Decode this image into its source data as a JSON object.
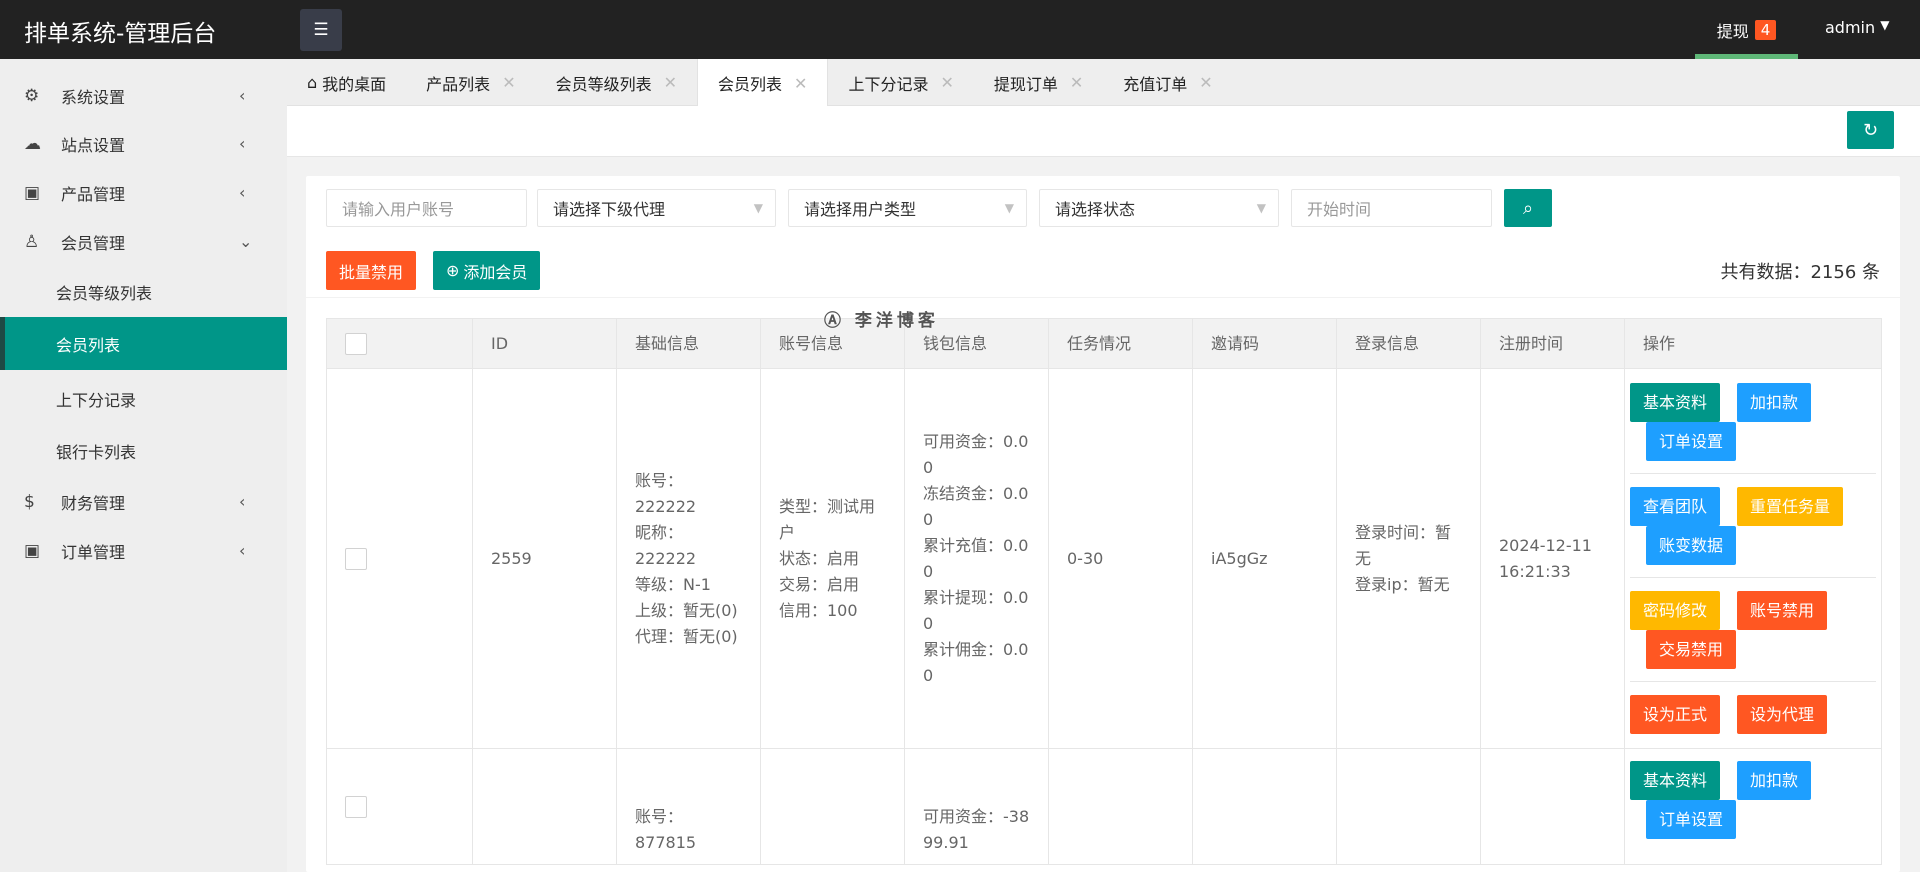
{
  "header": {
    "title": "排单系统-管理后台",
    "withdraw_label": "提现",
    "withdraw_count": "4",
    "user": "admin"
  },
  "sidebar": {
    "items": [
      {
        "label": "系统设置",
        "icon": "gear-icon"
      },
      {
        "label": "站点设置",
        "icon": "cloud-icon"
      },
      {
        "label": "产品管理",
        "icon": "box-icon"
      },
      {
        "label": "会员管理",
        "icon": "user-icon"
      },
      {
        "label": "会员等级列表"
      },
      {
        "label": "会员列表"
      },
      {
        "label": "上下分记录"
      },
      {
        "label": "银行卡列表"
      },
      {
        "label": "财务管理",
        "icon": "dollar-icon"
      },
      {
        "label": "订单管理",
        "icon": "box-icon"
      }
    ]
  },
  "tabs": [
    {
      "label": "我的桌面"
    },
    {
      "label": "产品列表"
    },
    {
      "label": "会员等级列表"
    },
    {
      "label": "会员列表"
    },
    {
      "label": "上下分记录"
    },
    {
      "label": "提现订单"
    },
    {
      "label": "充值订单"
    }
  ],
  "filters": {
    "account_placeholder": "请输入用户账号",
    "agent": "请选择下级代理",
    "user_type": "请选择用户类型",
    "status": "请选择状态",
    "start_placeholder": "开始时间"
  },
  "actions": {
    "batch_disable": "批量禁用",
    "add_member": "添加会员",
    "total": "共有数据：2156 条"
  },
  "watermark": "李洋博客",
  "table": {
    "headers": [
      "ID",
      "基础信息",
      "账号信息",
      "钱包信息",
      "任务情况",
      "邀请码",
      "登录信息",
      "注册时间",
      "操作"
    ],
    "rows": [
      {
        "id": "2559",
        "basic": [
          "账号：222222",
          "昵称：222222",
          "等级：N-1",
          "上级：暂无(0)",
          "代理：暂无(0)"
        ],
        "account": [
          "类型：测试用户",
          "状态：启用",
          "交易：启用",
          "信用：100"
        ],
        "wallet": [
          "可用资金：0.00",
          "冻结资金：0.00",
          "累计充值：0.00",
          "累计提现：0.00",
          "累计佣金：0.00"
        ],
        "task": "0-30",
        "invite": "iA5gGz",
        "login": [
          "登录时间：暂无",
          "登录ip：暂无"
        ],
        "reg": "2024-12-11 16:21:33"
      },
      {
        "id": "",
        "basic": [
          "账号：877815"
        ],
        "account": [],
        "wallet": [
          "可用资金：-3899.91"
        ],
        "task": "",
        "invite": "",
        "login": [],
        "reg": ""
      }
    ]
  },
  "ops": {
    "basic": "基本资料",
    "adjust": "加扣款",
    "order_set": "订单设置",
    "team": "查看团队",
    "reset_task": "重置任务量",
    "ledger": "账变数据",
    "pwd": "密码修改",
    "ban_account": "账号禁用",
    "ban_trade": "交易禁用",
    "set_formal": "设为正式",
    "set_agent": "设为代理"
  }
}
